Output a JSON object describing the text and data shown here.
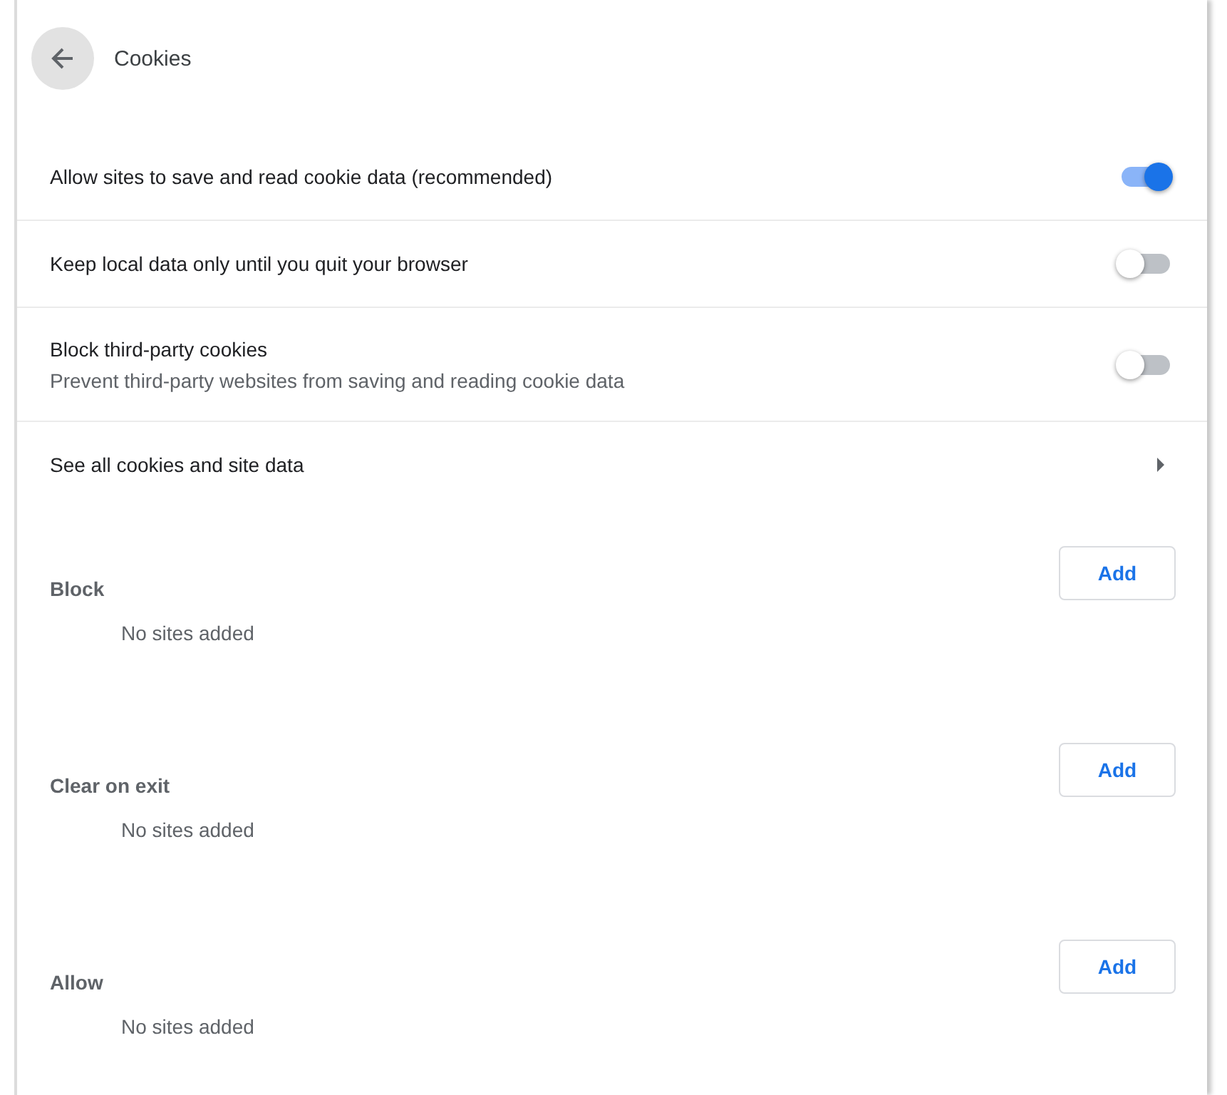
{
  "header": {
    "title": "Cookies"
  },
  "settings": [
    {
      "kind": "toggle",
      "label": "Allow sites to save and read cookie data (recommended)",
      "on": true
    },
    {
      "kind": "toggle",
      "label": "Keep local data only until you quit your browser",
      "on": false
    },
    {
      "kind": "toggle",
      "label": "Block third-party cookies",
      "description": "Prevent third-party websites from saving and reading cookie data",
      "on": false
    },
    {
      "kind": "link",
      "label": "See all cookies and site data"
    }
  ],
  "site_lists": [
    {
      "title": "Block",
      "button": "Add",
      "empty": "No sites added"
    },
    {
      "title": "Clear on exit",
      "button": "Add",
      "empty": "No sites added"
    },
    {
      "title": "Allow",
      "button": "Add",
      "empty": "No sites added"
    }
  ]
}
